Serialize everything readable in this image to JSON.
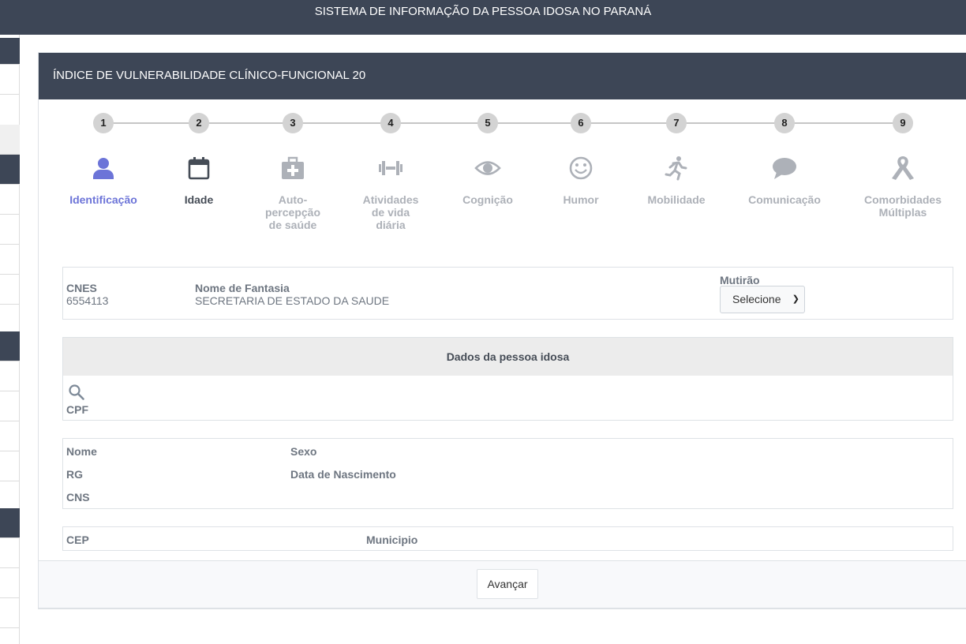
{
  "app": {
    "title": "SISTEMA DE INFORMAÇÃO DA PESSOA IDOSA NO PARANÁ"
  },
  "card": {
    "title": "ÍNDICE DE VULNERABILIDADE CLÍNICO-FUNCIONAL 20"
  },
  "steps": [
    {
      "num": "1",
      "label": "Identificação",
      "icon": "person-icon",
      "state": "active"
    },
    {
      "num": "2",
      "label": "Idade",
      "icon": "calendar-icon",
      "state": "done"
    },
    {
      "num": "3",
      "label": "Auto-\npercepção\nde saúde",
      "icon": "medkit-icon",
      "state": "pending"
    },
    {
      "num": "4",
      "label": "Atividades\nde vida\ndiária",
      "icon": "dumbbell-icon",
      "state": "pending"
    },
    {
      "num": "5",
      "label": "Cognição",
      "icon": "eye-icon",
      "state": "pending"
    },
    {
      "num": "6",
      "label": "Humor",
      "icon": "smile-icon",
      "state": "pending"
    },
    {
      "num": "7",
      "label": "Mobilidade",
      "icon": "running-icon",
      "state": "pending"
    },
    {
      "num": "8",
      "label": "Comunicação",
      "icon": "chat-icon",
      "state": "pending"
    },
    {
      "num": "9",
      "label": "Comorbidades\nMúltiplas",
      "icon": "ribbon-icon",
      "state": "pending"
    }
  ],
  "establishment": {
    "cnes_label": "CNES",
    "cnes_value": "6554113",
    "fantasia_label": "Nome de Fantasia",
    "fantasia_value": "SECRETARIA DE ESTADO DA SAUDE",
    "mutirao_label": "Mutirão",
    "mutirao_selected": "Selecione"
  },
  "person": {
    "section_title": "Dados da pessoa idosa",
    "search_icon": "search-icon",
    "cpf_label": "CPF",
    "nome_label": "Nome",
    "sexo_label": "Sexo",
    "rg_label": "RG",
    "nascimento_label": "Data de Nascimento",
    "cns_label": "CNS",
    "cep_label": "CEP",
    "municipio_label": "Municipio"
  },
  "footer": {
    "next_label": "Avançar"
  },
  "colors": {
    "header_bg": "#3d4656",
    "active_step": "#6c74d8",
    "inactive_step": "#adb1b8"
  }
}
